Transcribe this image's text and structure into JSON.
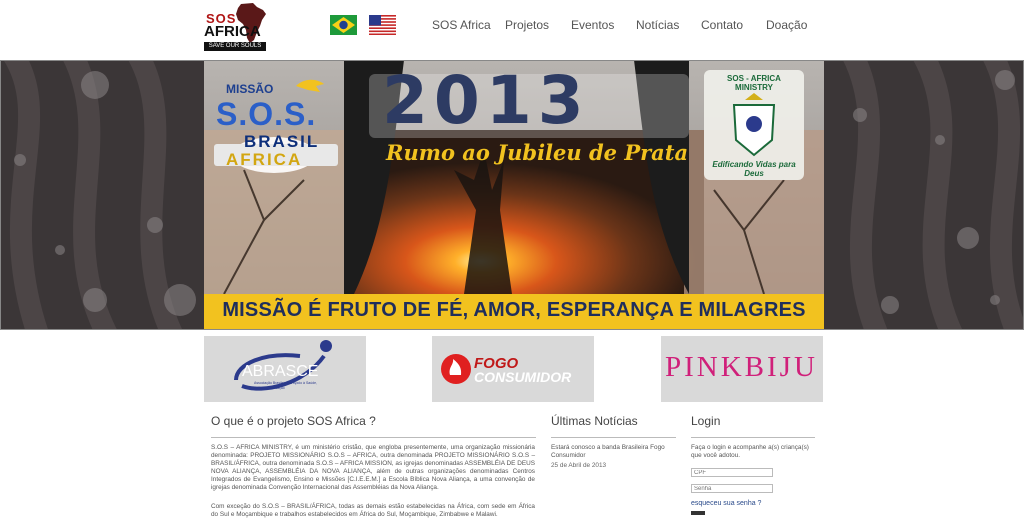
{
  "header": {
    "logo": {
      "line1": "SOS",
      "line2": "AFRICA",
      "tagline": "SAVE OUR SOULS"
    },
    "flags": [
      {
        "name": "brazil-flag-icon"
      },
      {
        "name": "usa-flag-icon"
      }
    ],
    "nav": [
      "SOS Africa",
      "Projetos",
      "Eventos",
      "Notícias",
      "Contato",
      "Doação"
    ]
  },
  "banner": {
    "left_logo": {
      "line1": "MISSÃO",
      "line2": "S.O.S.",
      "line3": "BRASIL",
      "line4": "AFRICA"
    },
    "year": "2013",
    "subtitle": "Rumo ao Jubileu de Prata",
    "right_logo": {
      "top": "SOS - AFRICA MINISTRY",
      "bottom": "Edificando Vidas para Deus"
    },
    "bottom_text": "MISSÃO É FRUTO DE FÉ, AMOR, ESPERANÇA E MILAGRES"
  },
  "partners": [
    {
      "name": "ABRASCE",
      "caption": "Associação Brasileira de Apoio à Saúde, Cultura e Educação"
    },
    {
      "name1": "FOGO",
      "name2": "CONSUMIDOR"
    },
    {
      "name": "PINKBIJU"
    }
  ],
  "about": {
    "title": "O que é o projeto SOS Africa ?",
    "para1": "S.O.S – AFRICA MINISTRY, é um ministério cristão, que engloba presentemente, uma organização missionária denominada: PROJETO MISSIONÁRIO S.O.S – AFRICA, outra denominada PROJETO MISSIONÁRIO S.O.S – BRASIL/ÁFRICA, outra denominada S.O.S – AFRICA MISSION, as igrejas denominadas ASSEMBLÉIA DE DEUS NOVA ALIANÇA, ASSEMBLÉIA DA NOVA ALIANÇA, além de outras organizações denominadas Centros Integrados de Evangelismo, Ensino e Missões [C.I.E.E.M.] a Escola Bíblica Nova Aliança, a uma convenção de igrejas denominada Convenção Internacional das Assembléias da Nova Aliança.",
    "para2": "Com exceção do S.O.S – BRASIL/ÁFRICA, todas as demais estão estabelecidas na África, com sede em África do Sul e Moçambique e trabalhos estabelecidos em África do Sul, Moçambique, Zimbabwe e Malawi."
  },
  "news": {
    "title": "Últimas Notícias",
    "items": [
      {
        "title": "Estará conosco a banda Brasileira Fogo Consumidor",
        "date": "25 de Abril de 2013"
      }
    ]
  },
  "login": {
    "title": "Login",
    "text": "Faça o login e acompanhe a(s) criança(s) que você adotou.",
    "cpf_placeholder": "CPF",
    "password_placeholder": "Senha",
    "forgot": "esqueceu sua senha ?"
  },
  "colors": {
    "accent_red": "#b01515",
    "banner_bg": "#3a3536",
    "yellow_band": "#f2c21f",
    "brand_blue": "#2b3a8c",
    "pink": "#d0207a"
  }
}
